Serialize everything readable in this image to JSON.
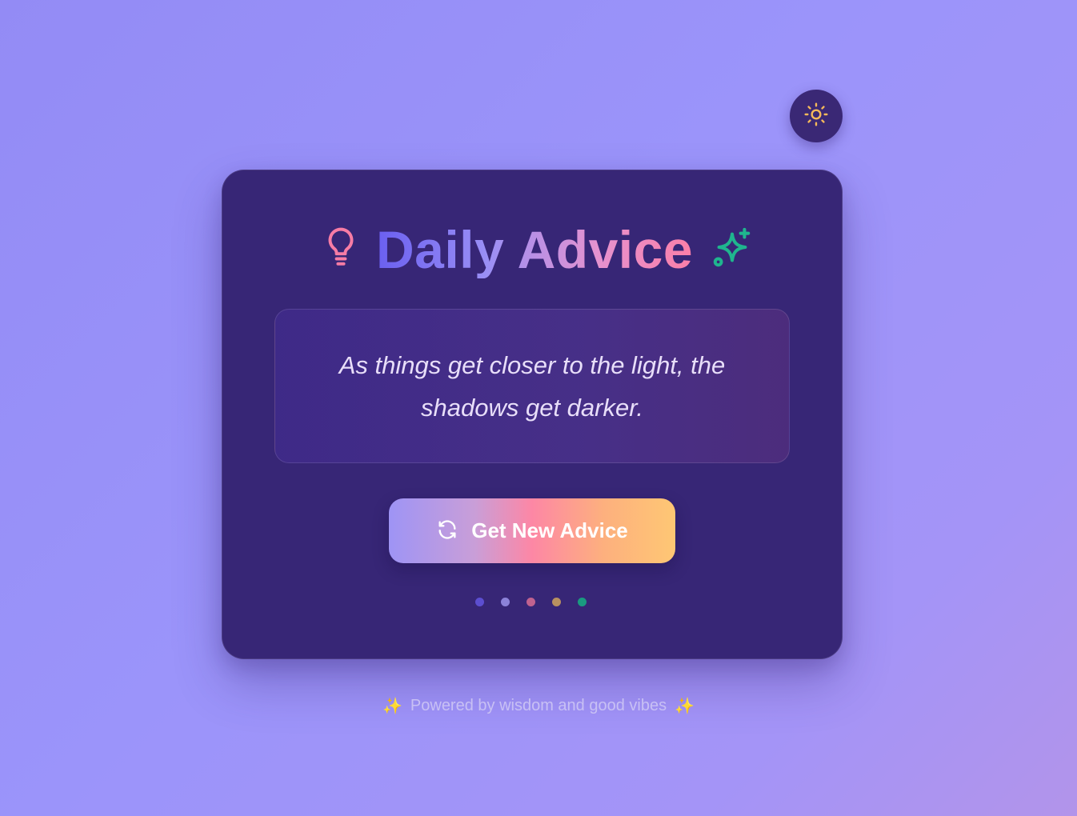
{
  "theme_toggle": {
    "icon": "sun-icon",
    "color": "#f5b95a"
  },
  "header": {
    "title": "Daily Advice",
    "left_icon": "lightbulb-icon",
    "right_icon": "sparkles-icon"
  },
  "advice": {
    "text": "As things get closer to the light, the shadows get darker."
  },
  "button": {
    "label": "Get New Advice",
    "icon": "refresh-icon"
  },
  "dots": [
    {
      "color": "#5c4ed0"
    },
    {
      "color": "#8c82d8"
    },
    {
      "color": "#c0628f"
    },
    {
      "color": "#b89060"
    },
    {
      "color": "#1a9a80"
    }
  ],
  "footer": {
    "text": "Powered by wisdom and good vibes",
    "left_emoji": "✨",
    "right_emoji": "✨"
  },
  "colors": {
    "background": "#9b94fa",
    "card": "#372676",
    "accent_pink": "#f77ca5",
    "accent_green": "#1fb58e"
  }
}
